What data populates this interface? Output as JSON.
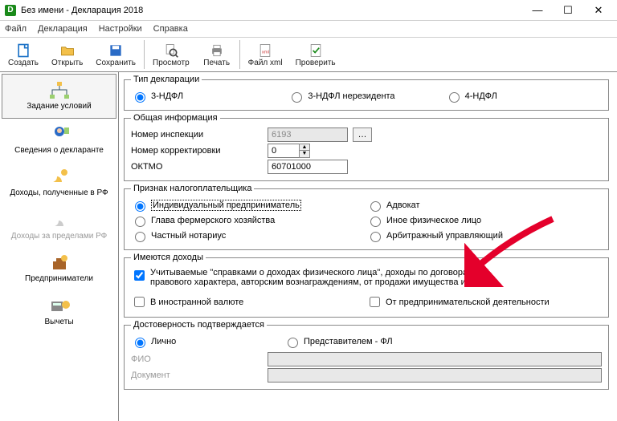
{
  "window": {
    "title": "Без имени - Декларация 2018"
  },
  "menu": {
    "file": "Файл",
    "decl": "Декларация",
    "settings": "Настройки",
    "help": "Справка"
  },
  "toolbar": {
    "create": "Создать",
    "open": "Открыть",
    "save": "Сохранить",
    "preview": "Просмотр",
    "print": "Печать",
    "xml": "Файл xml",
    "check": "Проверить"
  },
  "sidebar": {
    "conditions": "Задание условий",
    "declarant": "Сведения о декларанте",
    "income_rf": "Доходы, полученные в РФ",
    "income_abroad": "Доходы за пределами РФ",
    "entrepreneurs": "Предприниматели",
    "deductions": "Вычеты"
  },
  "groups": {
    "decl_type": "Тип декларации",
    "general": "Общая информация",
    "taxpayer_sign": "Признак налогоплательщика",
    "has_income": "Имеются доходы",
    "confirmation": "Достоверность подтверждается"
  },
  "decl_type_opts": {
    "ndfl3": "3-НДФЛ",
    "ndfl3_nr": "3-НДФЛ нерезидента",
    "ndfl4": "4-НДФЛ"
  },
  "general": {
    "inspection_label": "Номер инспекции",
    "inspection_value": "6193",
    "correction_label": "Номер корректировки",
    "correction_value": "0",
    "oktmo_label": "ОКТМО",
    "oktmo_value": "60701000"
  },
  "taxpayer_opts": {
    "ip": "Индивидуальный предприниматель",
    "farm": "Глава фермерского хозяйства",
    "notary": "Частный нотариус",
    "lawyer": "Адвокат",
    "other_person": "Иное физическое лицо",
    "arbitration": "Арбитражный управляющий"
  },
  "income_opts": {
    "spravka": "Учитываемые \"справками о доходах физического лица\", доходы по договорам гр.-правового характера, авторским вознаграждениям, от продажи имущества и др.",
    "foreign_currency": "В иностранной валюте",
    "entrepreneur_activity": "От предпринимательской деятельности"
  },
  "confirm_opts": {
    "personal": "Лично",
    "rep": "Представителем - ФЛ",
    "fio": "ФИО",
    "doc": "Документ"
  }
}
